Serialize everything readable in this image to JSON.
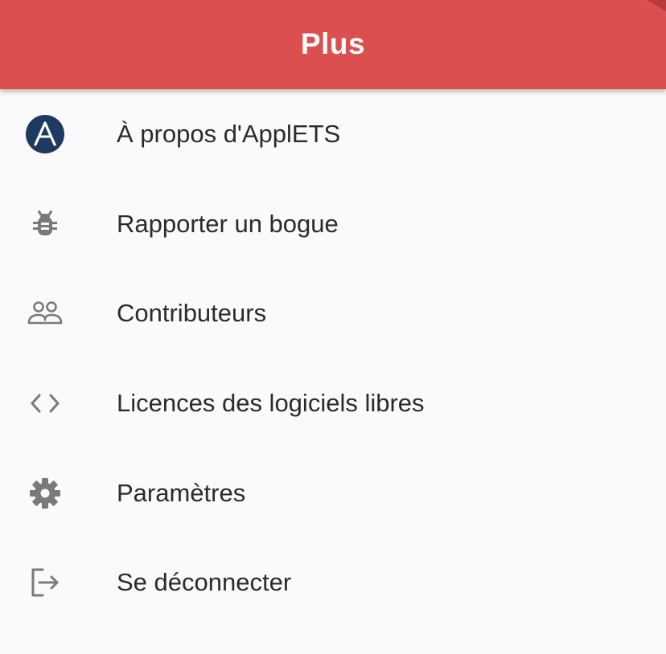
{
  "app_bar": {
    "title": "Plus",
    "background_color": "#dc4f4f"
  },
  "menu": {
    "items": [
      {
        "label": "À propos d'ApplETS",
        "icon": "applets-logo-icon"
      },
      {
        "label": "Rapporter un bogue",
        "icon": "bug-icon"
      },
      {
        "label": "Contributeurs",
        "icon": "people-icon"
      },
      {
        "label": "Licences des logiciels libres",
        "icon": "code-brackets-icon"
      },
      {
        "label": "Paramètres",
        "icon": "gear-icon"
      },
      {
        "label": "Se déconnecter",
        "icon": "logout-icon"
      }
    ]
  },
  "colors": {
    "logo_circle": "#1f3a60",
    "icon_gray": "#7a7a7a",
    "text": "#2b2b2b",
    "background": "#fafafa"
  }
}
